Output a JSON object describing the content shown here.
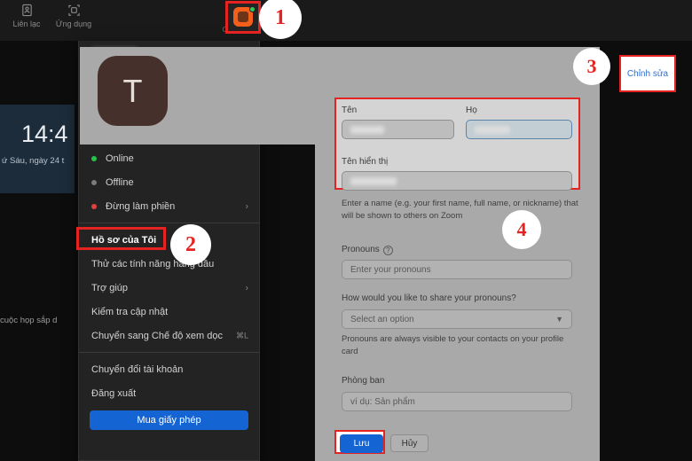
{
  "topbar": {
    "tabs": [
      {
        "label": "Liên lạc",
        "icon": "contacts-icon"
      },
      {
        "label": "Ứng dụng",
        "icon": "apps-icon"
      }
    ],
    "section_label": "CƠ BẢN",
    "app_icon_name": "zoom-app-icon",
    "status_dot": "online-green-dot"
  },
  "background": {
    "clock_time": "14:4",
    "clock_date": "ứ Sáu, ngày 24 t",
    "upcoming_text": "cuộc họp sắp d"
  },
  "menu": {
    "status_items": [
      {
        "label": "Online",
        "dot": "status-dot-online",
        "chevron": ""
      },
      {
        "label": "Offline",
        "dot": "status-dot-offline",
        "chevron": ""
      },
      {
        "label": "Đừng làm phiền",
        "dot": "status-dot-dnd",
        "chevron": "›"
      }
    ],
    "items": [
      {
        "label": "Hồ sơ của Tôi",
        "chevron": "",
        "shortcut": ""
      },
      {
        "label": "Thử các tính năng hàng đầu",
        "chevron": "",
        "shortcut": ""
      },
      {
        "label": "Trợ giúp",
        "chevron": "›",
        "shortcut": ""
      },
      {
        "label": "Kiểm tra cập nhật",
        "chevron": "",
        "shortcut": ""
      },
      {
        "label": "Chuyển sang Chế độ xem dọc",
        "chevron": "",
        "shortcut": "⌘L"
      }
    ],
    "account_items": [
      {
        "label": "Chuyển đổi tài khoản"
      },
      {
        "label": "Đăng xuất"
      }
    ],
    "license_button": "Mua giấy phép"
  },
  "profile": {
    "avatar_initial": "T",
    "edit_button": "Chỉnh sửa"
  },
  "form": {
    "first_name_label": "Tên",
    "first_name_value": "",
    "last_name_label": "Họ",
    "last_name_value": "",
    "display_name_label": "Tên hiển thị",
    "display_name_value": "",
    "name_helper": "Enter a name (e.g. your first name, full name, or nickname) that will be shown to others on Zoom",
    "pronouns_label": "Pronouns",
    "pronouns_placeholder": "Enter your pronouns",
    "pronouns_share_label": "How would you like to share your pronouns?",
    "pronouns_select_value": "Select an option",
    "pronouns_helper": "Pronouns are always visible to your contacts on your profile card",
    "department_label": "Phòng ban",
    "department_placeholder": "ví dụ: Sản phẩm",
    "save_button": "Lưu",
    "cancel_button": "Hủy"
  },
  "badges": {
    "one": "1",
    "two": "2",
    "three": "3",
    "four": "4"
  },
  "colors": {
    "accent_blue": "#1564d4",
    "highlight_red": "#e52421",
    "panel_gray": "#a9a9a9",
    "menu_dark": "#232323",
    "avatar_brown": "#45302b",
    "link_blue": "#2c6fd1"
  }
}
